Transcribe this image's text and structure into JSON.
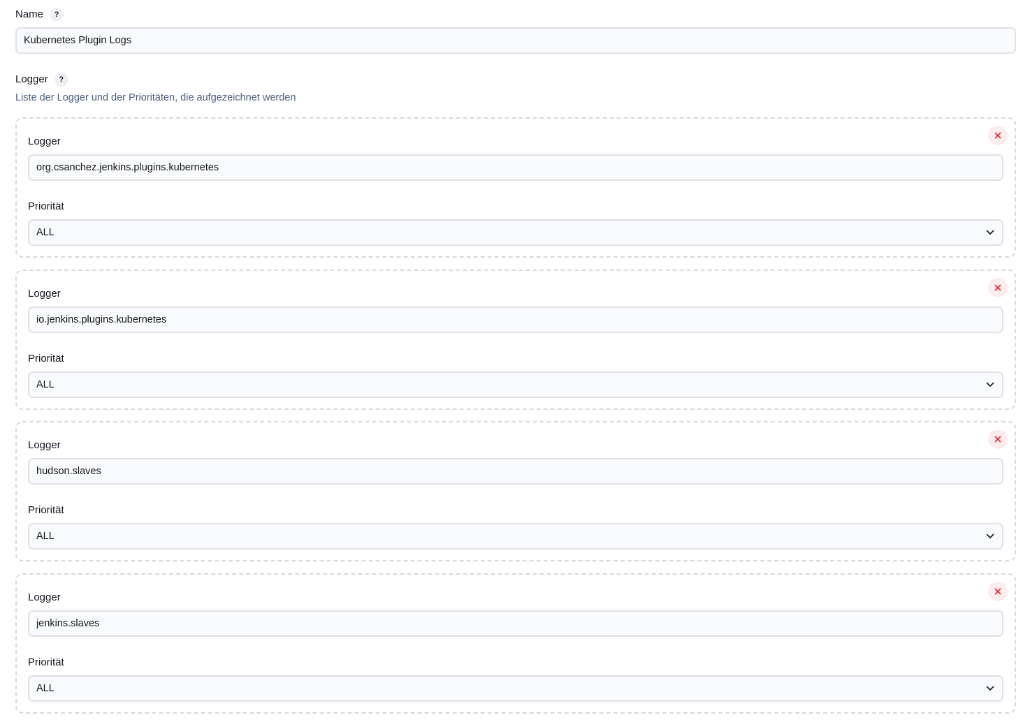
{
  "name_field": {
    "label": "Name",
    "help": "?",
    "value": "Kubernetes Plugin Logs"
  },
  "loggers_section": {
    "label": "Logger",
    "help": "?",
    "description": "Liste der Logger und der Prioritäten, die aufgezeichnet werden"
  },
  "entries": [
    {
      "logger_label": "Logger",
      "logger_value": "org.csanchez.jenkins.plugins.kubernetes",
      "priority_label": "Priorität",
      "priority_value": "ALL"
    },
    {
      "logger_label": "Logger",
      "logger_value": "io.jenkins.plugins.kubernetes",
      "priority_label": "Priorität",
      "priority_value": "ALL"
    },
    {
      "logger_label": "Logger",
      "logger_value": "hudson.slaves",
      "priority_label": "Priorität",
      "priority_value": "ALL"
    },
    {
      "logger_label": "Logger",
      "logger_value": "jenkins.slaves",
      "priority_label": "Priorität",
      "priority_value": "ALL"
    }
  ],
  "colors": {
    "delete_icon": "#e0282e",
    "delete_bg": "#fdeced",
    "description_text": "#4a5f7f",
    "input_border": "#dfe2e8",
    "dashed_border": "#d6d9e0"
  },
  "icons": {
    "help": "question-mark-icon",
    "delete": "close-icon",
    "select": "chevron-down-icon"
  }
}
